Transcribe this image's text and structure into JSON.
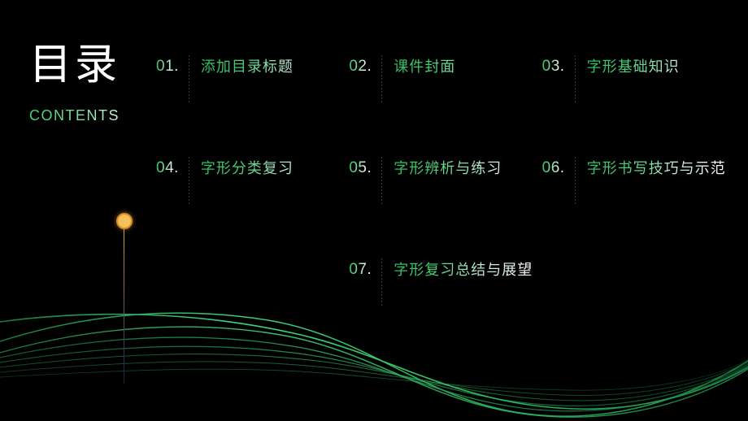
{
  "slide": {
    "title": "目录",
    "subtitle": "CONTENTS",
    "background_color": "#000000",
    "accent_green": "#2fbf63",
    "accent_amber": "#f3c05a",
    "divider_color": "#2b3d63"
  },
  "contents": {
    "items": [
      {
        "number": "01.",
        "label": "添加目录标题"
      },
      {
        "number": "02.",
        "label": "课件封面"
      },
      {
        "number": "03.",
        "label": "字形基础知识"
      },
      {
        "number": "04.",
        "label": "字形分类复习"
      },
      {
        "number": "05.",
        "label": "字形辨析与练习"
      },
      {
        "number": "06.",
        "label": "字形书写技巧与示范"
      },
      {
        "number": "07.",
        "label": "字形复习总结与展望"
      }
    ]
  },
  "decor": {
    "marker_icon": "amber-circle-marker",
    "wave_icon": "green-wave-lines"
  }
}
